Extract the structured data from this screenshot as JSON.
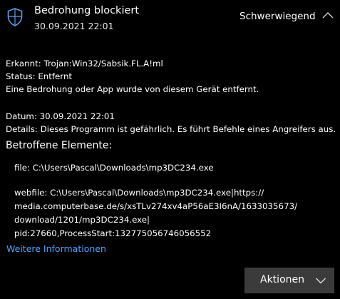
{
  "header": {
    "title": "Bedrohung blockiert",
    "timestamp": "30.09.2021 22:01",
    "severity": "Schwerwiegend",
    "icon": "shield-icon",
    "collapse_icon": "chevron-up-icon"
  },
  "details": {
    "detected_label": "Erkannt:",
    "detected_value": "Trojan:Win32/Sabsik.FL.A!ml",
    "status_label": "Status:",
    "status_value": "Entfernt",
    "description": "Eine Bedrohung oder App wurde von diesem Gerät entfernt.",
    "date_label": "Datum:",
    "date_value": "30.09.2021 22:01",
    "details_label": "Details:",
    "details_value": "Dieses Programm ist gefährlich. Es führt Befehle eines Angreifers aus."
  },
  "affected": {
    "title": "Betroffene Elemente:",
    "file": "file: C:\\Users\\Pascal\\Downloads\\mp3DC234.exe",
    "webfile_lines": [
      "webfile: C:\\Users\\Pascal\\Downloads\\mp3DC234.exe|https://",
      "media.computerbase.de/s/xsTLv274xv4aP56aE3I6nA/1633035673/",
      "download/1201/mp3DC234.exe|",
      "pid:27660,ProcessStart:132775056746056552"
    ]
  },
  "links": {
    "more_info": "Weitere Informationen"
  },
  "actions": {
    "label": "Aktionen",
    "icon": "chevron-down-icon"
  },
  "colors": {
    "background": "#000000",
    "link": "#4aa3ff",
    "button": "#3b3b3b",
    "icon": "#5aa0e6"
  }
}
